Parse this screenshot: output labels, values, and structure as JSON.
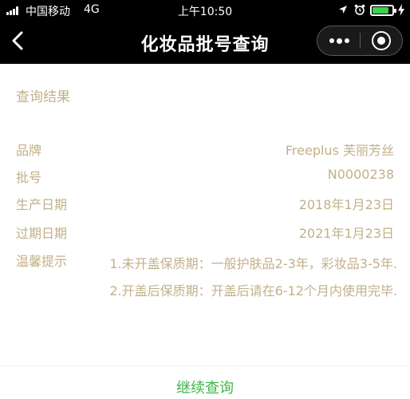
{
  "status_bar": {
    "carrier": "中国移动",
    "network": "4G",
    "time": "上午10:50",
    "battery_level": 0.85,
    "icons": [
      "signal-icon",
      "location-icon",
      "alarm-icon",
      "battery-icon",
      "charging-icon"
    ]
  },
  "nav": {
    "title": "化妆品批号查询",
    "back_icon": "chevron-left-icon",
    "more_icon": "more-icon",
    "close_icon": "close-circle-icon"
  },
  "result": {
    "section_title": "查询结果",
    "rows": [
      {
        "label": "品牌",
        "value": "Freeplus 芙丽芳丝"
      },
      {
        "label": "批号",
        "value": "N0000238"
      },
      {
        "label": "生产日期",
        "value": "2018年1月23日"
      },
      {
        "label": "过期日期",
        "value": "2021年1月23日"
      }
    ],
    "tips_label": "温馨提示",
    "tips": [
      "1.未开盖保质期：一般护肤品2-3年，彩妆品3-5年.",
      "2.开盖后保质期：开盖后请在6-12个月内使用完毕."
    ]
  },
  "actions": {
    "continue_label": "继续查询"
  },
  "colors": {
    "text_gold": "#c2b08a",
    "accent_green": "#3cb64a",
    "nav_bg": "#000000"
  }
}
